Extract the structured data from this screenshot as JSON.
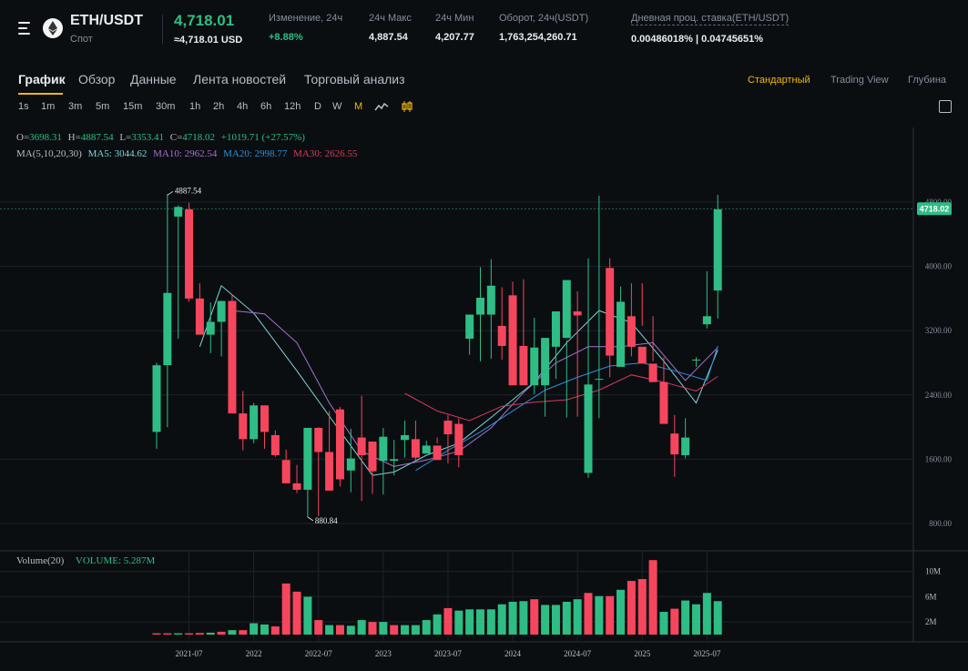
{
  "header": {
    "pair": "ETH/USDT",
    "market": "Спот",
    "price": "4,718.01",
    "price_usd": "≈4,718.01 USD",
    "stats": [
      {
        "label": "Изменение, 24ч",
        "value": "+8.88%",
        "green": true
      },
      {
        "label": "24ч Макс",
        "value": "4,887.54"
      },
      {
        "label": "24ч Мин",
        "value": "4,207.77"
      },
      {
        "label": "Оборот, 24ч(USDT)",
        "value": "1,763,254,260.71"
      },
      {
        "label": "Дневная проц. ставка(ETH/USDT)",
        "value": "0.00486018% | 0.04745651%"
      }
    ]
  },
  "tabs": [
    "График",
    "Обзор",
    "Данные",
    "Лента новостей",
    "Торговый анализ"
  ],
  "view_options": [
    "Стандартный",
    "Trading View",
    "Глубина"
  ],
  "intervals": [
    "1s",
    "1m",
    "3m",
    "5m",
    "15m",
    "30m",
    "1h",
    "2h",
    "4h",
    "6h",
    "12h",
    "D",
    "W",
    "M"
  ],
  "active_interval": "M",
  "ohlc": {
    "o_label": "O=",
    "o": "3698.31",
    "h_label": "H=",
    "h": "4887.54",
    "l_label": "L=",
    "l": "3353.41",
    "c_label": "C=",
    "c": "4718.02",
    "change": "+1019.71 (+27.57%)"
  },
  "ma": {
    "label": "MA(5,10,20,30)",
    "ma5": "MA5: 3044.62",
    "ma10": "MA10: 2962.54",
    "ma20": "MA20: 2998.77",
    "ma30": "MA30: 2626.55"
  },
  "volume_info": {
    "label": "Volume(20)",
    "value": "VOLUME: 5.287M"
  },
  "colors": {
    "up": "#2ebd85",
    "down": "#f6465d",
    "ma5": "#7fd4d8",
    "ma10": "#a970d0",
    "ma20": "#2f8fd8",
    "ma30": "#d63a5c",
    "accent": "#f0b90b"
  },
  "chart_data": {
    "type": "candlestick",
    "interval": "1M",
    "x_tick_labels": [
      "2021-07",
      "2022",
      "2022-07",
      "2023",
      "2023-07",
      "2024",
      "2024-07",
      "2025",
      "2025-07"
    ],
    "y_ticks": [
      800,
      1600,
      2400,
      3200,
      4000,
      4800
    ],
    "y_tick_labels": [
      "800.00",
      "1600.00",
      "2400.00",
      "3200.00",
      "4000.00",
      "4800.00"
    ],
    "last_price_label": "4718.02",
    "last_price": 4718.02,
    "high_annotation": "4887.54",
    "high_value": 4887.54,
    "low_annotation": "880.84",
    "low_value": 880.84,
    "volume_ticks": [
      2,
      6,
      10
    ],
    "volume_tick_labels": [
      "2M",
      "6M",
      "10M"
    ],
    "months": [
      "2021-04",
      "2021-05",
      "2021-06",
      "2021-07",
      "2021-08",
      "2021-09",
      "2021-10",
      "2021-11",
      "2021-12",
      "2022-01",
      "2022-02",
      "2022-03",
      "2022-04",
      "2022-05",
      "2022-06",
      "2022-07",
      "2022-08",
      "2022-09",
      "2022-10",
      "2022-11",
      "2022-12",
      "2023-01",
      "2023-02",
      "2023-03",
      "2023-04",
      "2023-05",
      "2023-06",
      "2023-07",
      "2023-08",
      "2023-09",
      "2023-10",
      "2023-11",
      "2023-12",
      "2024-01",
      "2024-02",
      "2024-03",
      "2024-04",
      "2024-05",
      "2024-06",
      "2024-07",
      "2024-08",
      "2024-09",
      "2024-10",
      "2024-11",
      "2024-12",
      "2025-01",
      "2025-02",
      "2025-03",
      "2025-04",
      "2025-05",
      "2025-06",
      "2025-07",
      "2025-08"
    ],
    "open": [
      1940,
      2770,
      4620,
      4710,
      3600,
      3150,
      3310,
      3570,
      2170,
      1850,
      2270,
      1900,
      1590,
      1300,
      1220,
      1990,
      1690,
      2220,
      1460,
      1870,
      1820,
      1580,
      1580,
      1840,
      1850,
      1670,
      1770,
      2080,
      2040,
      3100,
      3400,
      3400,
      3260,
      3640,
      3010,
      2520,
      2520,
      3000,
      3110,
      3440,
      1430,
      2590,
      3980,
      2750,
      3380,
      3000,
      2790,
      2560,
      1920,
      1650,
      2840,
      3280,
      3700
    ],
    "high": [
      2800,
      4900,
      4760,
      4790,
      3790,
      3550,
      3540,
      3650,
      2450,
      2300,
      2270,
      1960,
      1720,
      1530,
      1790,
      2000,
      2200,
      2250,
      1980,
      2390,
      1740,
      1990,
      1840,
      2080,
      2080,
      1830,
      1870,
      2150,
      2110,
      3360,
      3990,
      4090,
      3740,
      3810,
      3840,
      3360,
      3080,
      3440,
      3080,
      3690,
      4100,
      4880,
      4100,
      3750,
      3790,
      3790,
      3380,
      2870,
      2150,
      2110,
      2870,
      3940,
      4890
    ],
    "low": [
      1730,
      2000,
      3100,
      3560,
      3540,
      2920,
      2880,
      3390,
      1710,
      1800,
      1730,
      1630,
      1330,
      1180,
      880,
      890,
      1420,
      1260,
      1190,
      1080,
      1170,
      1160,
      1400,
      1620,
      1560,
      1740,
      1800,
      1550,
      1500,
      2900,
      2820,
      2850,
      2840,
      3010,
      2830,
      2410,
      2130,
      2600,
      2120,
      2130,
      1370,
      2110,
      2620,
      2760,
      2880,
      3260,
      2820,
      2260,
      1380,
      1610,
      2750,
      3230,
      3350
    ],
    "close": [
      2770,
      3670,
      4740,
      3600,
      3150,
      3310,
      3570,
      2170,
      1850,
      2270,
      1940,
      1650,
      1300,
      1220,
      1990,
      1690,
      1210,
      1350,
      1610,
      1650,
      1450,
      1880,
      1600,
      1900,
      1620,
      1770,
      1590,
      1910,
      1650,
      3400,
      3610,
      3760,
      3010,
      2520,
      2520,
      2990,
      3110,
      3440,
      3830,
      3390,
      2530,
      2600,
      2890,
      3560,
      3000,
      2790,
      2560,
      2040,
      1660,
      1870,
      2840,
      3380,
      4710
    ],
    "volume": [
      0.2,
      0.2,
      0.2,
      0.2,
      0.25,
      0.3,
      0.45,
      0.7,
      0.7,
      1.8,
      1.6,
      1.3,
      8.1,
      6.8,
      6.0,
      2.3,
      1.5,
      1.5,
      1.4,
      2.3,
      2.0,
      2.0,
      1.5,
      1.5,
      1.5,
      2.3,
      3.2,
      4.2,
      3.8,
      4.0,
      4.0,
      4.0,
      4.8,
      5.2,
      5.3,
      5.6,
      4.7,
      4.7,
      5.2,
      5.6,
      6.6,
      6.1,
      6.1,
      7.1,
      8.5,
      8.8,
      11.8,
      3.6,
      4.1,
      5.4,
      4.8,
      6.6,
      5.3
    ],
    "volume_up": [
      false,
      false,
      true,
      false,
      false,
      true,
      false,
      true,
      false,
      true,
      true,
      false,
      false,
      false,
      true,
      false,
      true,
      false,
      true,
      true,
      false,
      true,
      false,
      true,
      true,
      true,
      true,
      false,
      true,
      true,
      true,
      true,
      true,
      true,
      true,
      false,
      true,
      true,
      true,
      true,
      false,
      true,
      false,
      true,
      false,
      false,
      false,
      true,
      false,
      true,
      true,
      true,
      true
    ],
    "ma_series": {
      "ma5": [
        [
          4,
          3000
        ],
        [
          6,
          3760
        ],
        [
          9,
          3420
        ],
        [
          13,
          2700
        ],
        [
          17,
          1950
        ],
        [
          20,
          1400
        ],
        [
          22,
          1440
        ],
        [
          25,
          1650
        ],
        [
          28,
          1800
        ],
        [
          31,
          2120
        ],
        [
          35,
          2560
        ],
        [
          38,
          3050
        ],
        [
          41,
          3450
        ],
        [
          44,
          3300
        ],
        [
          47,
          2820
        ],
        [
          50,
          2300
        ],
        [
          52,
          2960
        ]
      ],
      "ma10": [
        [
          7,
          3450
        ],
        [
          10,
          3410
        ],
        [
          13,
          3050
        ],
        [
          16,
          2300
        ],
        [
          19,
          1700
        ],
        [
          22,
          1510
        ],
        [
          25,
          1590
        ],
        [
          28,
          1700
        ],
        [
          31,
          1990
        ],
        [
          34,
          2430
        ],
        [
          37,
          2800
        ],
        [
          40,
          3000
        ],
        [
          43,
          3000
        ],
        [
          46,
          3050
        ],
        [
          49,
          2580
        ],
        [
          52,
          2990
        ]
      ],
      "ma20": [
        [
          24,
          1460
        ],
        [
          27,
          1710
        ],
        [
          30,
          1940
        ],
        [
          33,
          2200
        ],
        [
          36,
          2460
        ],
        [
          39,
          2620
        ],
        [
          42,
          2760
        ],
        [
          45,
          2800
        ],
        [
          48,
          2700
        ],
        [
          51,
          2580
        ],
        [
          52,
          3010
        ]
      ],
      "ma30": [
        [
          23,
          2420
        ],
        [
          26,
          2200
        ],
        [
          29,
          2080
        ],
        [
          32,
          2260
        ],
        [
          35,
          2310
        ],
        [
          38,
          2340
        ],
        [
          41,
          2460
        ],
        [
          44,
          2650
        ],
        [
          47,
          2560
        ],
        [
          50,
          2450
        ],
        [
          52,
          2630
        ]
      ]
    }
  }
}
